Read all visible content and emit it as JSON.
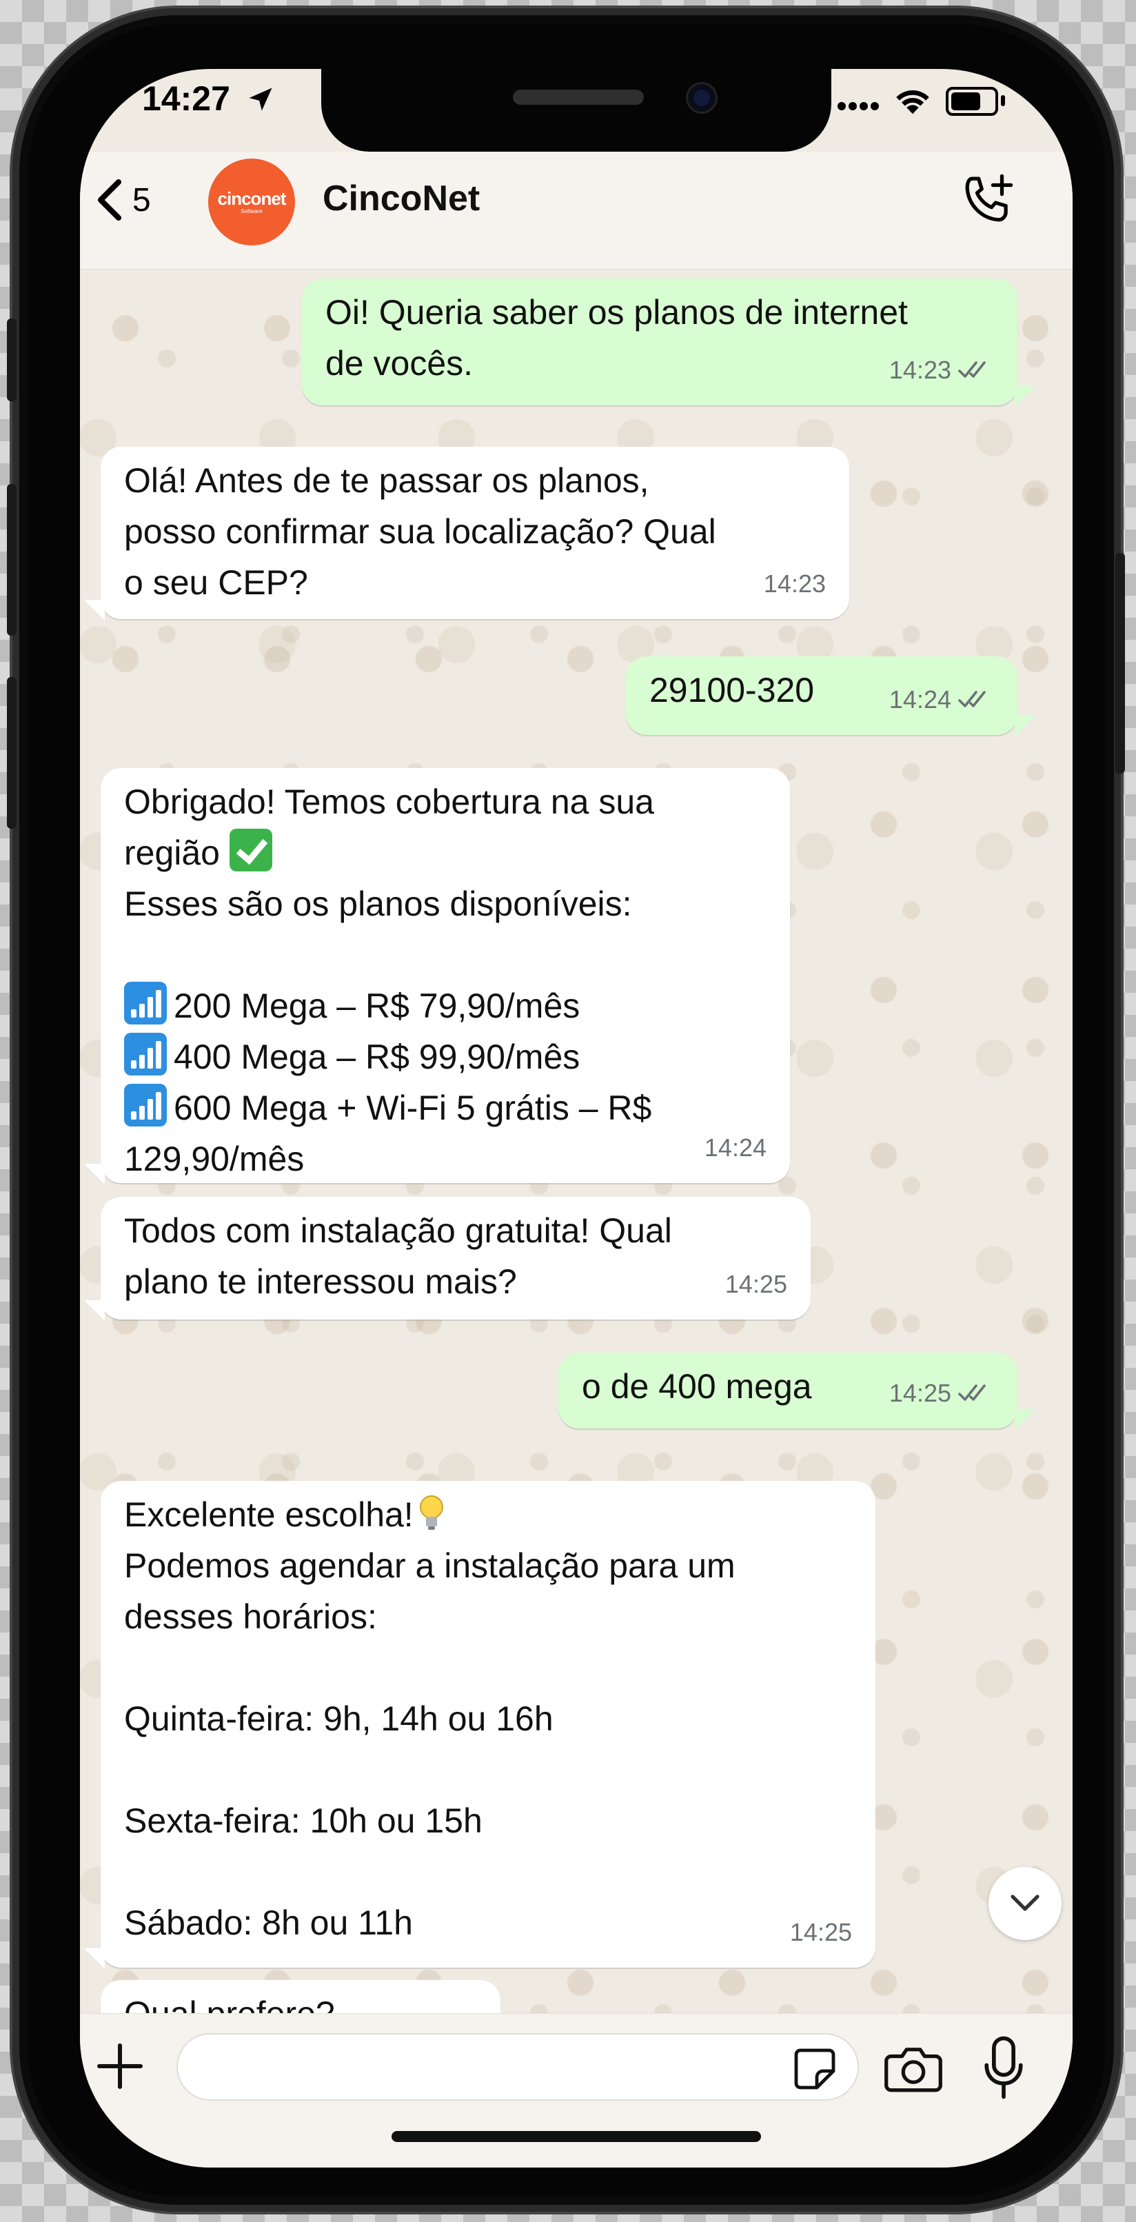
{
  "status_bar": {
    "time": "14:27"
  },
  "header": {
    "back_count": "5",
    "contact_name": "CincoNet",
    "avatar_brand": "cinconet",
    "avatar_sub": "Software"
  },
  "messages": [
    {
      "body": "Oi! Queria saber os planos de internet\nde vocês.",
      "time": "14:23",
      "direction": "out"
    },
    {
      "body": "Olá! Antes de te passar os planos,\nposso confirmar sua localização? Qual\no seu CEP?",
      "time": "14:23",
      "direction": "in"
    },
    {
      "body": "29100-320",
      "time": "14:24",
      "direction": "out"
    },
    {
      "intro_line1": "Obrigado! Temos cobertura na sua",
      "intro_line2": "região",
      "intro_line3": "Esses são os planos disponíveis:",
      "plans": [
        "200 Mega – R$ 79,90/mês",
        "400 Mega – R$ 99,90/mês",
        "600 Mega + Wi-Fi 5 grátis – R$",
        "129,90/mês"
      ],
      "time": "14:24",
      "direction": "in"
    },
    {
      "body": "Todos com instalação gratuita! Qual\nplano te interessou mais?",
      "time": "14:25",
      "direction": "in"
    },
    {
      "body": "o de 400 mega",
      "time": "14:25",
      "direction": "out"
    },
    {
      "line1": "Excelente escolha!",
      "body": "Podemos agendar a instalação para um\ndesses horários:\n\nQuinta-feira: 9h, 14h ou 16h\n\nSexta-feira: 10h ou 15h\n\nSábado: 8h ou 11h",
      "time": "14:25",
      "direction": "in"
    },
    {
      "body": "Qual prefere?",
      "direction": "in"
    }
  ],
  "composer": {
    "placeholder": ""
  },
  "icons": {
    "emoji_check": "white-check-mark-emoji",
    "emoji_signal": "antenna-bars-emoji",
    "emoji_bulb": "light-bulb-emoji"
  },
  "colors": {
    "outgoing_bubble": "#d8fdd2",
    "incoming_bubble": "#ffffff",
    "avatar": "#f25e2e",
    "chat_bg": "#efeae2"
  }
}
